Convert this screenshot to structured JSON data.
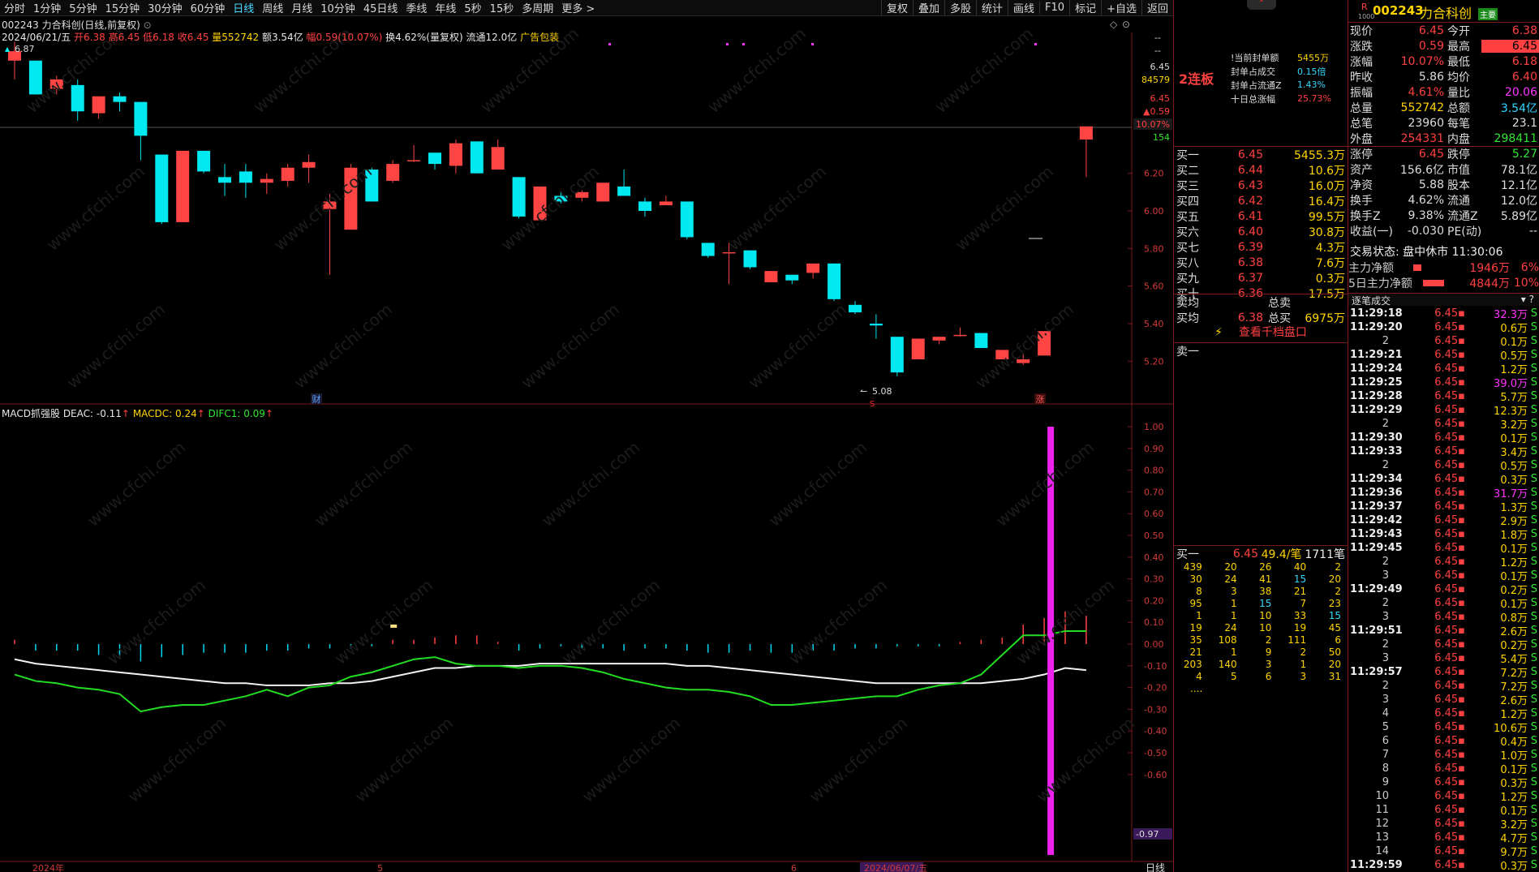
{
  "toolbar": {
    "periods": [
      "分时",
      "1分钟",
      "5分钟",
      "15分钟",
      "30分钟",
      "60分钟",
      "日线",
      "周线",
      "月线",
      "10分钟",
      "45日线",
      "季线",
      "年线",
      "5秒",
      "15秒",
      "多周期",
      "更多 >"
    ],
    "selected_period": "日线",
    "tools": [
      "复权",
      "叠加",
      "多股",
      "统计",
      "画线",
      "F10",
      "标记",
      "+自选",
      "返回"
    ]
  },
  "stock": {
    "code": "002243",
    "name": "力合科创",
    "title_line": "002243 力合科创(日线,前复权)"
  },
  "info_bar": {
    "date": "2024/06/21/五",
    "open": "开6.38",
    "high": "高6.45",
    "low": "低6.18",
    "close": "收6.45",
    "volume": "量552742",
    "amount": "额3.54亿",
    "change": "幅0.59(10.07%)",
    "turnover": "换4.62%(量复权)",
    "float": "流通12.0亿",
    "ad": "广告包装"
  },
  "macd_info": {
    "name": "MACD抓强股",
    "deac": "DEAC: -0.11",
    "macdc": "MACDC: 0.24",
    "difc": "DIFC1: 0.09"
  },
  "axis": {
    "price_ticks": [
      "6.00",
      "5.80",
      "5.60",
      "5.40",
      "5.20",
      "6.20"
    ],
    "right_labels": [
      "6.45",
      "84579",
      "6.45",
      "▲0.59",
      "10.07%",
      "154"
    ],
    "macd_ticks": [
      "1.00",
      "0.90",
      "0.80",
      "0.70",
      "0.60",
      "0.50",
      "0.40",
      "0.30",
      "0.20",
      "0.10",
      "0.00",
      "-0.10",
      "-0.20",
      "-0.30",
      "-0.40",
      "-0.50",
      "-0.60"
    ],
    "macd_current": "-0.97",
    "date_labels": [
      "2024年",
      "5",
      "6",
      "2024/06/07/五"
    ],
    "period_label": "日线",
    "high_label": "6.87",
    "low_label": "5.08"
  },
  "markers": {
    "fin": "财",
    "zhang": "涨",
    "s": "S"
  },
  "chart_data": {
    "type": "candlestick",
    "candles": [
      [
        6.8,
        6.9,
        6.7,
        6.85
      ],
      [
        6.8,
        6.8,
        6.62,
        6.62
      ],
      [
        6.65,
        6.72,
        6.62,
        6.7
      ],
      [
        6.67,
        6.7,
        6.48,
        6.53
      ],
      [
        6.52,
        6.6,
        6.49,
        6.61
      ],
      [
        6.61,
        6.63,
        6.53,
        6.58
      ],
      [
        6.58,
        6.58,
        6.27,
        6.4
      ],
      [
        6.3,
        6.3,
        5.93,
        5.94
      ],
      [
        5.94,
        6.32,
        5.94,
        6.32
      ],
      [
        6.32,
        6.32,
        6.2,
        6.21
      ],
      [
        6.18,
        6.25,
        6.08,
        6.15
      ],
      [
        6.21,
        6.25,
        6.07,
        6.15
      ],
      [
        6.15,
        6.2,
        6.09,
        6.17
      ],
      [
        6.16,
        6.25,
        6.13,
        6.23
      ],
      [
        6.23,
        6.3,
        6.15,
        6.26
      ],
      [
        6.01,
        6.09,
        5.66,
        6.05
      ],
      [
        5.9,
        6.25,
        5.9,
        6.23
      ],
      [
        6.22,
        6.23,
        6.05,
        6.05
      ],
      [
        6.16,
        6.27,
        6.15,
        6.25
      ],
      [
        6.27,
        6.35,
        6.26,
        6.27
      ],
      [
        6.31,
        6.31,
        6.22,
        6.25
      ],
      [
        6.24,
        6.38,
        6.2,
        6.36
      ],
      [
        6.37,
        6.37,
        6.2,
        6.2
      ],
      [
        6.22,
        6.38,
        6.22,
        6.34
      ],
      [
        6.18,
        6.18,
        5.96,
        5.97
      ],
      [
        5.95,
        6.13,
        5.95,
        6.13
      ],
      [
        6.08,
        6.1,
        6.04,
        6.05
      ],
      [
        6.07,
        6.11,
        6.05,
        6.1
      ],
      [
        6.05,
        6.15,
        6.05,
        6.15
      ],
      [
        6.13,
        6.22,
        6.08,
        6.08
      ],
      [
        6.05,
        6.07,
        5.97,
        6.0
      ],
      [
        6.03,
        6.08,
        6.03,
        6.05
      ],
      [
        6.05,
        6.05,
        5.85,
        5.86
      ],
      [
        5.83,
        5.83,
        5.75,
        5.76
      ],
      [
        5.78,
        5.83,
        5.61,
        5.78
      ],
      [
        5.79,
        5.79,
        5.69,
        5.7
      ],
      [
        5.62,
        5.68,
        5.62,
        5.68
      ],
      [
        5.66,
        5.66,
        5.61,
        5.63
      ],
      [
        5.67,
        5.72,
        5.64,
        5.72
      ],
      [
        5.72,
        5.72,
        5.52,
        5.53
      ],
      [
        5.5,
        5.52,
        5.45,
        5.46
      ],
      [
        5.4,
        5.45,
        5.32,
        5.39
      ],
      [
        5.33,
        5.33,
        5.12,
        5.14
      ],
      [
        5.21,
        5.32,
        5.21,
        5.32
      ],
      [
        5.31,
        5.33,
        5.29,
        5.33
      ],
      [
        5.34,
        5.38,
        5.33,
        5.34
      ],
      [
        5.35,
        5.35,
        5.27,
        5.27
      ],
      [
        5.21,
        5.26,
        5.21,
        5.26
      ],
      [
        5.19,
        5.24,
        5.18,
        5.21
      ],
      [
        5.23,
        5.36,
        5.23,
        5.36
      ],
      [
        5.34,
        5.39,
        5.31,
        5.35
      ],
      [
        6.38,
        6.45,
        6.18,
        6.45
      ]
    ],
    "hidden_from": 50,
    "ylim": [
      5.05,
      6.95
    ],
    "macd": {
      "white": [
        -0.07,
        -0.09,
        -0.1,
        -0.11,
        -0.12,
        -0.13,
        -0.14,
        -0.15,
        -0.16,
        -0.17,
        -0.18,
        -0.18,
        -0.19,
        -0.19,
        -0.19,
        -0.18,
        -0.18,
        -0.17,
        -0.15,
        -0.13,
        -0.11,
        -0.11,
        -0.1,
        -0.1,
        -0.1,
        -0.09,
        -0.09,
        -0.09,
        -0.09,
        -0.09,
        -0.09,
        -0.09,
        -0.1,
        -0.1,
        -0.11,
        -0.12,
        -0.13,
        -0.14,
        -0.15,
        -0.16,
        -0.17,
        -0.18,
        -0.18,
        -0.18,
        -0.18,
        -0.18,
        -0.18,
        -0.17,
        -0.16,
        -0.14,
        -0.11,
        -0.12
      ],
      "green": [
        -0.14,
        -0.17,
        -0.18,
        -0.2,
        -0.21,
        -0.23,
        -0.31,
        -0.29,
        -0.28,
        -0.28,
        -0.26,
        -0.24,
        -0.21,
        -0.24,
        -0.2,
        -0.19,
        -0.15,
        -0.13,
        -0.1,
        -0.07,
        -0.06,
        -0.09,
        -0.1,
        -0.1,
        -0.11,
        -0.1,
        -0.1,
        -0.11,
        -0.13,
        -0.16,
        -0.18,
        -0.2,
        -0.21,
        -0.21,
        -0.22,
        -0.24,
        -0.28,
        -0.28,
        -0.27,
        -0.26,
        -0.25,
        -0.24,
        -0.24,
        -0.21,
        -0.19,
        -0.18,
        -0.14,
        -0.05,
        0.04,
        0.04,
        0.06,
        0.06
      ],
      "bars": [
        0.02,
        -0.03,
        -0.03,
        -0.03,
        -0.05,
        -0.06,
        -0.08,
        -0.06,
        -0.05,
        -0.04,
        -0.04,
        -0.04,
        -0.03,
        -0.03,
        -0.02,
        -0.02,
        -0.02,
        -0.01,
        0.02,
        0.02,
        0.03,
        0.04,
        0.04,
        0.01,
        -0.03,
        -0.02,
        -0.01,
        -0.02,
        -0.02,
        -0.03,
        -0.02,
        -0.02,
        -0.03,
        -0.04,
        -0.04,
        -0.03,
        -0.04,
        -0.04,
        -0.03,
        -0.03,
        -0.02,
        -0.02,
        -0.01,
        -0.01,
        -0.01,
        0.01,
        0.02,
        0.03,
        0.09,
        0.12,
        0.15,
        0.13
      ],
      "spike": {
        "index": 49,
        "top": 1.0,
        "bottom": -0.97
      }
    },
    "macd_ylim": [
      -1.0,
      1.03
    ]
  },
  "limit_panel": {
    "label": "2连板",
    "rows": [
      {
        "k": "!当前封单额",
        "v": "5455万"
      },
      {
        "k": "封单占成交",
        "v": "0.15倍"
      },
      {
        "k": "封单占流通Z",
        "v": "1.43%"
      },
      {
        "k": "十日总涨幅",
        "v": "25.73%"
      }
    ]
  },
  "quote": {
    "rows": [
      [
        "现价",
        "6.45",
        "今开",
        "6.38"
      ],
      [
        "涨跌",
        "0.59",
        "最高",
        "6.45"
      ],
      [
        "涨幅",
        "10.07%",
        "最低",
        "6.18"
      ],
      [
        "昨收",
        "5.86",
        "均价",
        "6.40"
      ],
      [
        "振幅",
        "4.61%",
        "量比",
        "20.06"
      ],
      [
        "总量",
        "552742",
        "总额",
        "3.54亿"
      ],
      [
        "总笔",
        "23960",
        "每笔",
        "23.1"
      ],
      [
        "外盘",
        "254331",
        "内盘",
        "298411"
      ],
      [
        "涨停",
        "6.45",
        "跌停",
        "5.27"
      ],
      [
        "资产",
        "156.6亿",
        "市值",
        "78.1亿"
      ],
      [
        "净资",
        "5.88",
        "股本",
        "12.1亿"
      ],
      [
        "换手",
        "4.62%",
        "流通",
        "12.0亿"
      ],
      [
        "换手Z",
        "9.38%",
        "流通Z",
        "5.89亿"
      ],
      [
        "收益(一)",
        "-0.030",
        "PE(动)",
        "--"
      ]
    ],
    "status": "交易状态: 盘中休市 11:30:06",
    "main_net": {
      "k": "主力净额",
      "v": "1946万",
      "p": "6%"
    },
    "main_net5": {
      "k": "5日主力净额",
      "v": "4844万",
      "p": "10%"
    },
    "ticker_tag": "R",
    "ticker_sub": "1000",
    "ticker_badge": "主要"
  },
  "bids": [
    [
      "买一",
      "6.45",
      "5455.3万"
    ],
    [
      "买二",
      "6.44",
      "10.6万"
    ],
    [
      "买三",
      "6.43",
      "16.0万"
    ],
    [
      "买四",
      "6.42",
      "16.4万"
    ],
    [
      "买五",
      "6.41",
      "99.5万"
    ],
    [
      "买六",
      "6.40",
      "30.8万"
    ],
    [
      "买七",
      "6.39",
      "4.3万"
    ],
    [
      "买八",
      "6.38",
      "7.6万"
    ],
    [
      "买九",
      "6.37",
      "0.3万"
    ],
    [
      "买十",
      "6.36",
      "17.5万"
    ]
  ],
  "avg_rows": [
    [
      "卖均",
      "",
      "总卖",
      ""
    ],
    [
      "买均",
      "6.38",
      "总买",
      "6975万"
    ]
  ],
  "depth_button": "查看千档盘口",
  "sell1": "卖一",
  "queue": {
    "header": [
      "买一",
      "6.45",
      "49.4/笔",
      "1711笔"
    ],
    "rows": [
      [
        "439",
        "20",
        "26",
        "40",
        "2"
      ],
      [
        "30",
        "24",
        "41",
        "15",
        "20"
      ],
      [
        "8",
        "3",
        "38",
        "21",
        "2"
      ],
      [
        "95",
        "1",
        "15",
        "7",
        "23"
      ],
      [
        "1",
        "1",
        "10",
        "33",
        "15"
      ],
      [
        "19",
        "24",
        "10",
        "19",
        "45"
      ],
      [
        "35",
        "108",
        "2",
        "111",
        "6"
      ],
      [
        "21",
        "1",
        "9",
        "2",
        "50"
      ],
      [
        "203",
        "140",
        "3",
        "1",
        "20"
      ],
      [
        "4",
        "5",
        "6",
        "3",
        "31"
      ]
    ],
    "more": "...."
  },
  "ticks": {
    "title": "逐笔成交",
    "rows": [
      [
        "11:29:18",
        "6.45",
        "32.3万"
      ],
      [
        "11:29:20",
        "6.45",
        "0.6万"
      ],
      [
        "2",
        "6.45",
        "0.1万"
      ],
      [
        "11:29:21",
        "6.45",
        "0.5万"
      ],
      [
        "11:29:24",
        "6.45",
        "1.2万"
      ],
      [
        "11:29:25",
        "6.45",
        "39.0万"
      ],
      [
        "11:29:28",
        "6.45",
        "5.7万"
      ],
      [
        "11:29:29",
        "6.45",
        "12.3万"
      ],
      [
        "2",
        "6.45",
        "3.2万"
      ],
      [
        "11:29:30",
        "6.45",
        "0.1万"
      ],
      [
        "11:29:33",
        "6.45",
        "3.4万"
      ],
      [
        "2",
        "6.45",
        "0.5万"
      ],
      [
        "11:29:34",
        "6.45",
        "0.3万"
      ],
      [
        "11:29:36",
        "6.45",
        "31.7万"
      ],
      [
        "11:29:37",
        "6.45",
        "1.3万"
      ],
      [
        "11:29:42",
        "6.45",
        "2.9万"
      ],
      [
        "11:29:43",
        "6.45",
        "1.8万"
      ],
      [
        "11:29:45",
        "6.45",
        "0.1万"
      ],
      [
        "2",
        "6.45",
        "1.2万"
      ],
      [
        "3",
        "6.45",
        "0.1万"
      ],
      [
        "11:29:49",
        "6.45",
        "0.2万"
      ],
      [
        "2",
        "6.45",
        "0.1万"
      ],
      [
        "3",
        "6.45",
        "0.8万"
      ],
      [
        "11:29:51",
        "6.45",
        "2.6万"
      ],
      [
        "2",
        "6.45",
        "0.2万"
      ],
      [
        "3",
        "6.45",
        "5.4万"
      ],
      [
        "11:29:57",
        "6.45",
        "7.2万"
      ],
      [
        "2",
        "6.45",
        "7.2万"
      ],
      [
        "3",
        "6.45",
        "2.6万"
      ],
      [
        "4",
        "6.45",
        "1.2万"
      ],
      [
        "5",
        "6.45",
        "10.6万"
      ],
      [
        "6",
        "6.45",
        "0.4万"
      ],
      [
        "7",
        "6.45",
        "1.0万"
      ],
      [
        "8",
        "6.45",
        "0.1万"
      ],
      [
        "9",
        "6.45",
        "0.3万"
      ],
      [
        "10",
        "6.45",
        "1.2万"
      ],
      [
        "11",
        "6.45",
        "0.1万"
      ],
      [
        "12",
        "6.45",
        "3.2万"
      ],
      [
        "13",
        "6.45",
        "4.7万"
      ],
      [
        "14",
        "6.45",
        "9.7万"
      ],
      [
        "11:29:59",
        "6.45",
        "0.3万"
      ]
    ],
    "flag": "S"
  }
}
